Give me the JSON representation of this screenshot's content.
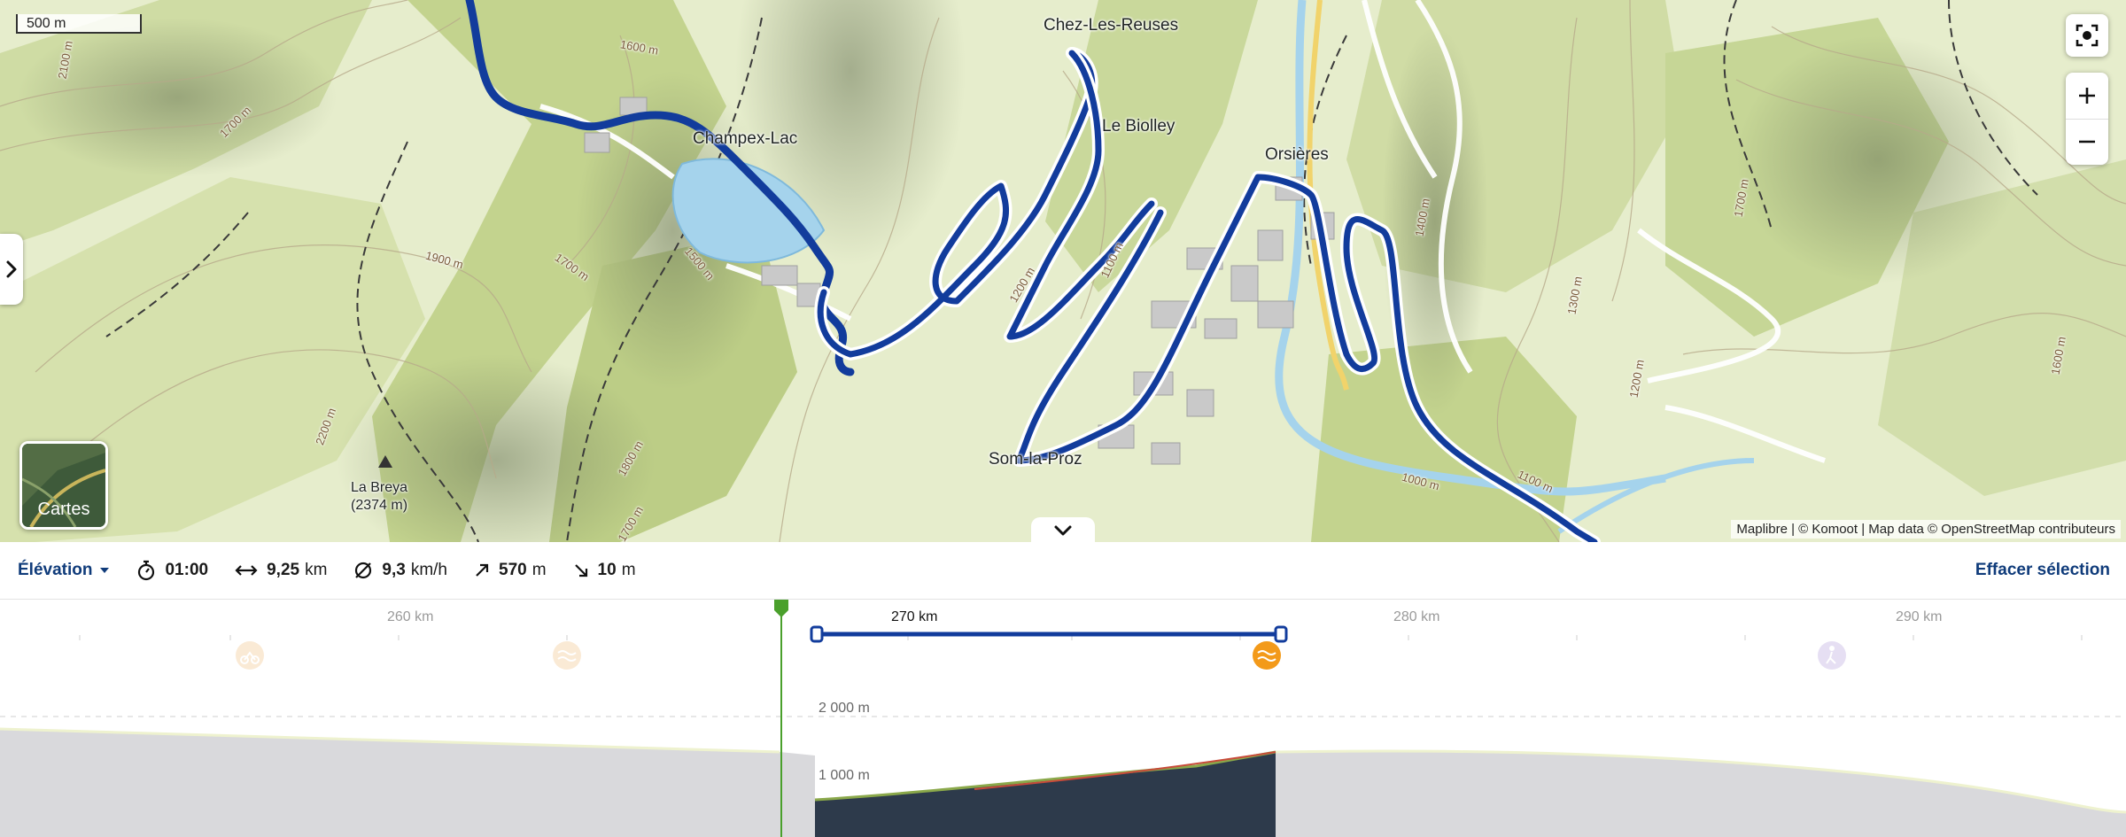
{
  "map": {
    "scale_label": "500 m",
    "places": [
      {
        "name": "Chez-Les-Reuses"
      },
      {
        "name": "Champex-Lac"
      },
      {
        "name": "Le Biolley"
      },
      {
        "name": "Orsières"
      },
      {
        "name": "Som-la-Proz"
      },
      {
        "name": "La Breya"
      },
      {
        "name": "(2374 m)"
      }
    ],
    "contour_labels": [
      "2100 m",
      "1600 m",
      "1700 m",
      "1900 m",
      "1700 m",
      "1500 m",
      "2200 m",
      "1800 m",
      "1700 m",
      "1200 m",
      "1100 m",
      "1000 m",
      "1100 m",
      "1200 m",
      "1300 m",
      "1400 m",
      "1700 m",
      "1600 m"
    ],
    "layers_label": "Cartes",
    "attribution": "Maplibre | © Komoot | Map data © OpenStreetMap contributeurs",
    "colors": {
      "route": "#123c9c",
      "water": "#a5d3ec",
      "road": "#f1d36b"
    }
  },
  "stats": {
    "view_selector": "Élévation",
    "duration": "01:00",
    "distance_value": "9,25",
    "distance_unit": "km",
    "speed_value": "9,3",
    "speed_unit": "km/h",
    "ascent_value": "570",
    "ascent_unit": "m",
    "descent_value": "10",
    "descent_unit": "m",
    "clear_selection": "Effacer sélection"
  },
  "profile": {
    "km_ticks": [
      "260 km",
      "270 km",
      "280 km",
      "290 km"
    ],
    "selection_label": "270 km",
    "elevation_labels": [
      "2 000 m",
      "1 000 m"
    ],
    "colors": {
      "selection": "#123c9c",
      "marker": "#4aa02c",
      "fill": "#2d3a4b",
      "outside": "#d9d9dc"
    }
  }
}
